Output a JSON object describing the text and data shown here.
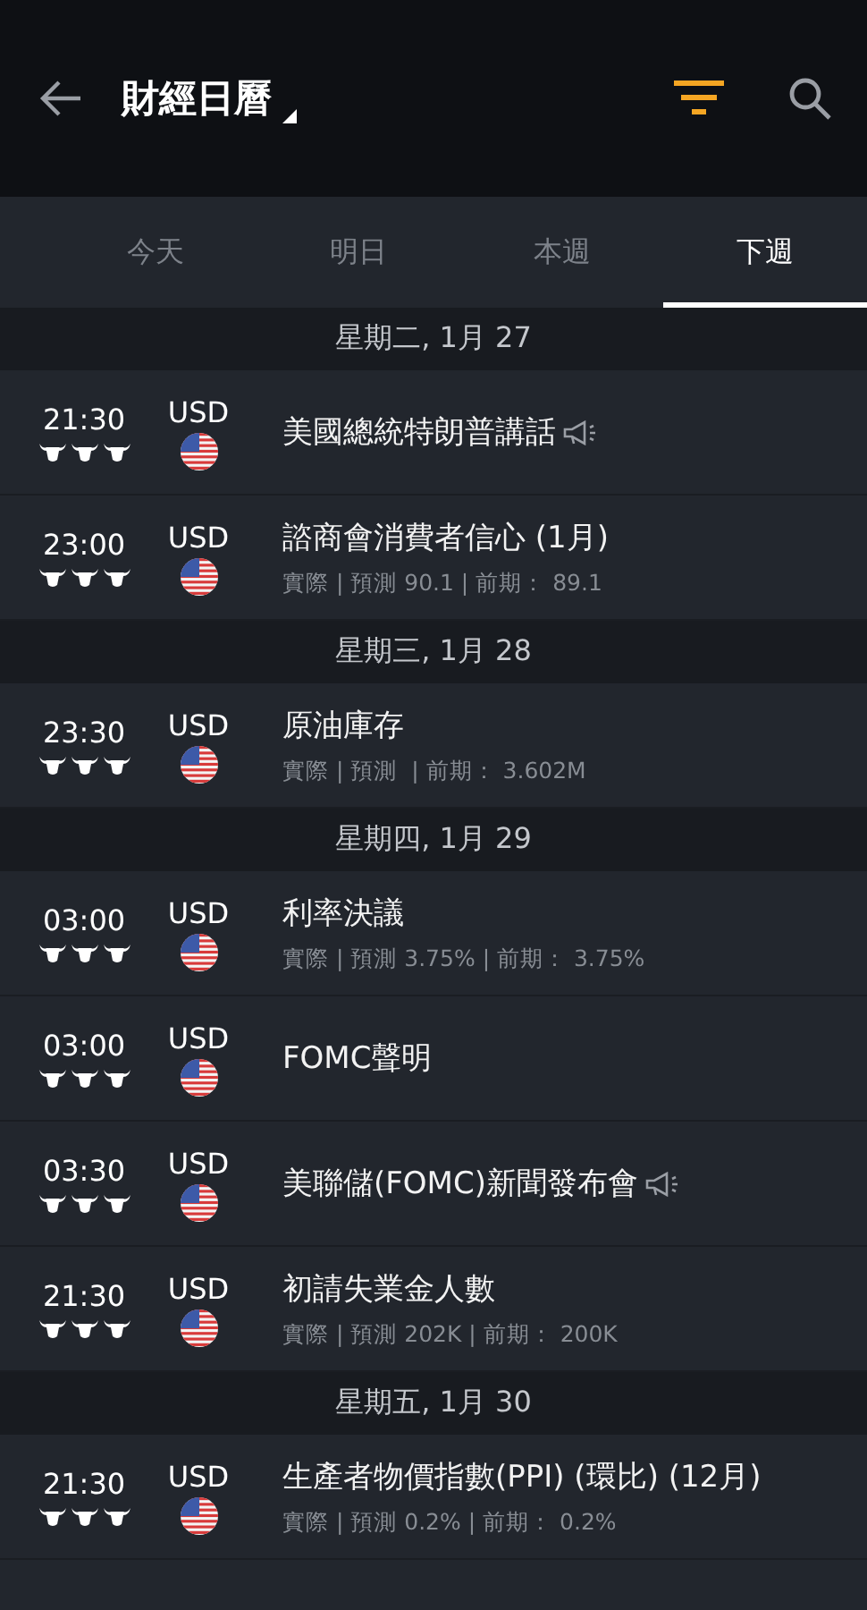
{
  "header": {
    "title": "財經日曆"
  },
  "tabs": [
    {
      "label": "今天",
      "selected": false
    },
    {
      "label": "明日",
      "selected": false
    },
    {
      "label": "本週",
      "selected": false
    },
    {
      "label": "下週",
      "selected": true
    }
  ],
  "days": [
    {
      "date": "星期二, 1月 27",
      "events": [
        {
          "time": "21:30",
          "stars": 3,
          "currency": "USD",
          "title": "美國總統特朗普講話",
          "speech": true
        },
        {
          "time": "23:00",
          "stars": 3,
          "currency": "USD",
          "title": "諮商會消費者信心 (1月)",
          "speech": false,
          "detail": "實際 | 預測 90.1 | 前期： 89.1"
        }
      ]
    },
    {
      "date": "星期三, 1月 28",
      "events": [
        {
          "time": "23:30",
          "stars": 3,
          "currency": "USD",
          "title": "原油庫存",
          "speech": false,
          "detail": "實際 | 預測  | 前期： 3.602M"
        }
      ]
    },
    {
      "date": "星期四, 1月 29",
      "events": [
        {
          "time": "03:00",
          "stars": 3,
          "currency": "USD",
          "title": "利率決議",
          "speech": false,
          "detail": "實際 | 預測 3.75% | 前期： 3.75%"
        },
        {
          "time": "03:00",
          "stars": 3,
          "currency": "USD",
          "title": "FOMC聲明",
          "speech": false
        },
        {
          "time": "03:30",
          "stars": 3,
          "currency": "USD",
          "title": "美聯儲(FOMC)新聞發布會",
          "speech": true
        },
        {
          "time": "21:30",
          "stars": 3,
          "currency": "USD",
          "title": "初請失業金人數",
          "speech": false,
          "detail": "實際 | 預測 202K | 前期： 200K"
        }
      ]
    },
    {
      "date": "星期五, 1月 30",
      "events": [
        {
          "time": "21:30",
          "stars": 3,
          "currency": "USD",
          "title": "生產者物價指數(PPI) (環比) (12月)",
          "speech": false,
          "detail": "實際 | 預測 0.2% | 前期： 0.2%"
        }
      ]
    }
  ]
}
